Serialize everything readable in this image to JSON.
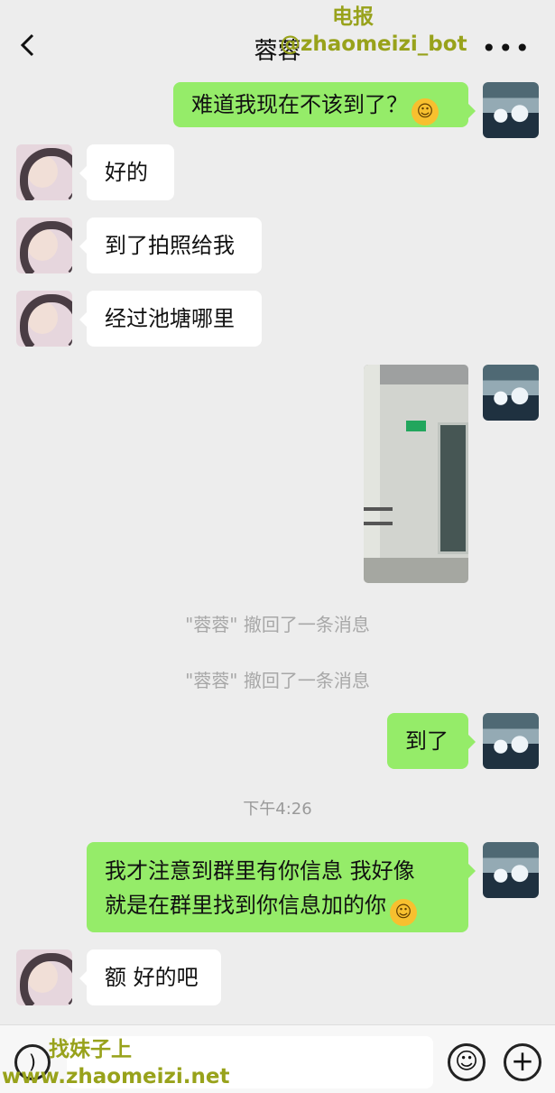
{
  "header": {
    "title": "蓉蓉",
    "back_icon": "chevron-left-icon",
    "more_icon": "ellipsis-icon"
  },
  "watermarks": {
    "top_line1": "电报",
    "top_line2": "@zhaomeizi_bot",
    "bottom_line1": "找妹子上",
    "bottom_line2": "www.zhaomeizi.net"
  },
  "messages": [
    {
      "side": "right",
      "text": "难道我现在不该到了？"
    },
    {
      "side": "left",
      "text": "好的"
    },
    {
      "side": "left",
      "text": "到了拍照给我"
    },
    {
      "side": "left",
      "text": "经过池塘哪里"
    },
    {
      "side": "right",
      "text": "到了"
    },
    {
      "side": "right",
      "line1": "我才注意到群里有你信息   我好像",
      "line2": "就是在群里找到你信息加的你"
    },
    {
      "side": "left",
      "text": "额 好的吧"
    }
  ],
  "system_notices": [
    "\"蓉蓉\" 撤回了一条消息",
    "\"蓉蓉\" 撤回了一条消息"
  ],
  "time_label": "下午4:26",
  "emoji_face": "facepalm-emoji-icon",
  "input_bar": {
    "voice_icon": "voice-icon",
    "emoji_icon": "smile-icon",
    "plus_icon": "plus-icon"
  }
}
